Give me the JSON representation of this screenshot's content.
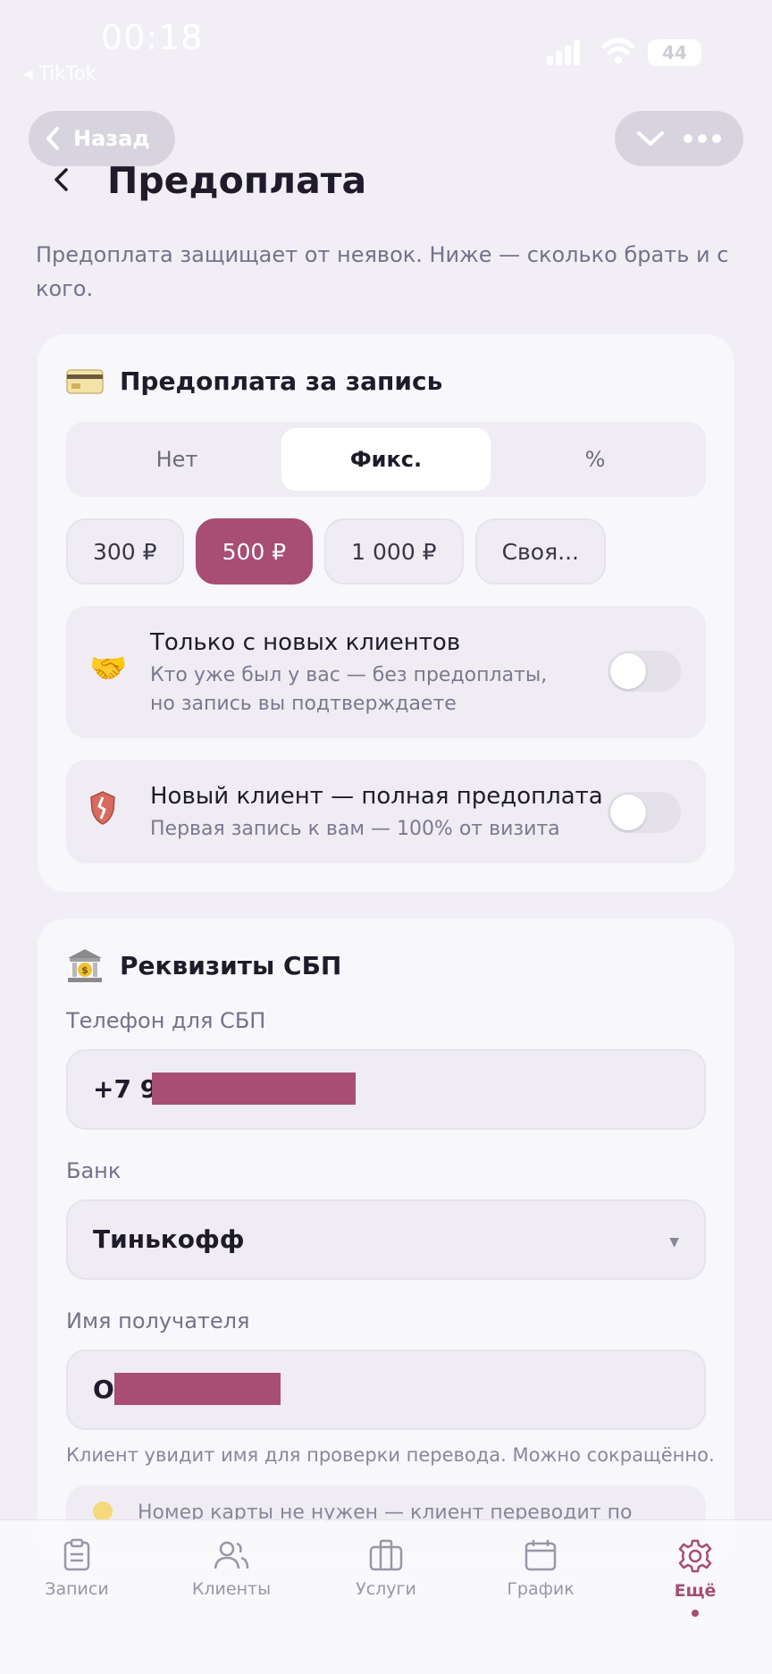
{
  "status_bar": {
    "time": "00:18",
    "back_app": "◂ TikTok",
    "battery": "44"
  },
  "nav": {
    "back_label": "Назад"
  },
  "page": {
    "title": "Предоплата",
    "description": "Предоплата защищает от неявок. Ниже — сколько брать и с кого."
  },
  "prepayment_card": {
    "title": "Предоплата за запись",
    "icon": "credit-card-icon",
    "segments": [
      "Нет",
      "Фикс.",
      "%"
    ],
    "selected_segment": "Фикс.",
    "amount_chips": [
      "300 ₽",
      "500 ₽",
      "1 000 ₽",
      "Своя..."
    ],
    "selected_amount": "500 ₽",
    "options": [
      {
        "icon": "handshake-icon",
        "title": "Только с новых клиентов",
        "subtitle": "Кто уже был у вас — без предоплаты, но запись вы подтверждаете",
        "enabled": false
      },
      {
        "icon": "shield-icon",
        "title": "Новый клиент — полная предоплата",
        "subtitle": "Первая запись к вам — 100% от визита",
        "enabled": false
      }
    ]
  },
  "sbp_card": {
    "title": "Реквизиты СБП",
    "icon": "bank-icon",
    "phone_label": "Телефон для СБП",
    "phone_value": "+7  9",
    "bank_label": "Банк",
    "bank_value": "Тинькофф",
    "recipient_label": "Имя получателя",
    "recipient_value": "О",
    "recipient_hint": "Клиент увидит имя для проверки перевода. Можно сокращённо.",
    "note": "Номер карты не нужен — клиент переводит по"
  },
  "tabbar": {
    "tabs": [
      {
        "label": "Записи",
        "icon": "clipboard-icon"
      },
      {
        "label": "Клиенты",
        "icon": "users-icon"
      },
      {
        "label": "Услуги",
        "icon": "briefcase-icon"
      },
      {
        "label": "График",
        "icon": "calendar-icon"
      },
      {
        "label": "Ещё",
        "icon": "gear-icon"
      }
    ],
    "active": "Ещё"
  },
  "colors": {
    "accent": "#a84d74",
    "background": "#f1eff5",
    "card": "#f8f7fb"
  }
}
